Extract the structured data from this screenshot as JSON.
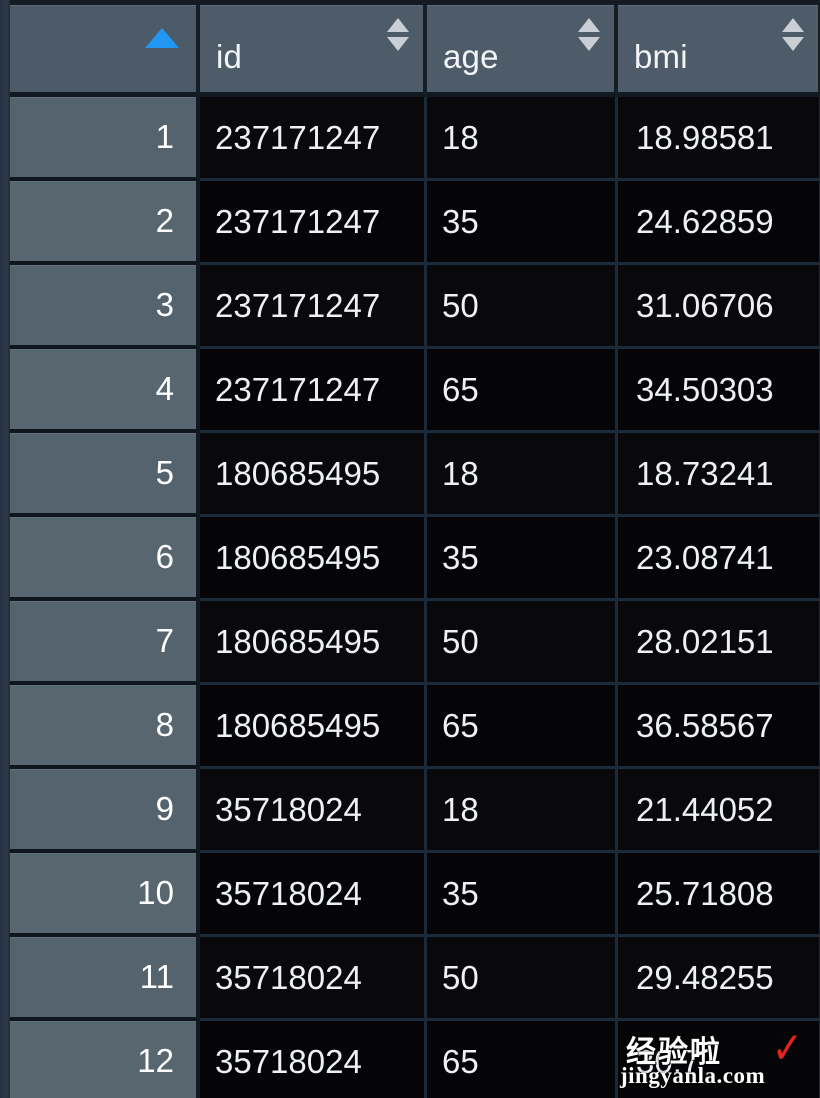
{
  "grid": {
    "sort": {
      "active_column": "row-number",
      "direction": "ascending",
      "accent_color": "#2196f3"
    },
    "colors": {
      "header_background": "#4e5c6a",
      "rownum_background": "#55636f",
      "cell_background": "#09090c",
      "cell_text": "#eef1f3",
      "grid_line": "#1b2a38"
    },
    "columns": [
      {
        "key": "rownum",
        "label": "",
        "sortable": true,
        "sort_state": "asc"
      },
      {
        "key": "id",
        "label": "id",
        "sortable": true,
        "sort_state": "none"
      },
      {
        "key": "age",
        "label": "age",
        "sortable": true,
        "sort_state": "none"
      },
      {
        "key": "bmi",
        "label": "bmi",
        "sortable": true,
        "sort_state": "none"
      }
    ],
    "rows": [
      {
        "rownum": "1",
        "id": "237171247",
        "age": "18",
        "bmi": "18.98581"
      },
      {
        "rownum": "2",
        "id": "237171247",
        "age": "35",
        "bmi": "24.62859"
      },
      {
        "rownum": "3",
        "id": "237171247",
        "age": "50",
        "bmi": "31.06706"
      },
      {
        "rownum": "4",
        "id": "237171247",
        "age": "65",
        "bmi": "34.50303"
      },
      {
        "rownum": "5",
        "id": "180685495",
        "age": "18",
        "bmi": "18.73241"
      },
      {
        "rownum": "6",
        "id": "180685495",
        "age": "35",
        "bmi": "23.08741"
      },
      {
        "rownum": "7",
        "id": "180685495",
        "age": "50",
        "bmi": "28.02151"
      },
      {
        "rownum": "8",
        "id": "180685495",
        "age": "65",
        "bmi": "36.58567"
      },
      {
        "rownum": "9",
        "id": "35718024",
        "age": "18",
        "bmi": "21.44052"
      },
      {
        "rownum": "10",
        "id": "35718024",
        "age": "35",
        "bmi": "25.71808"
      },
      {
        "rownum": "11",
        "id": "35718024",
        "age": "50",
        "bmi": "29.48255"
      },
      {
        "rownum": "12",
        "id": "35718024",
        "age": "65",
        "bmi": "30.7"
      }
    ]
  },
  "watermark": {
    "brand_cn": "经验啦",
    "check_glyph": "✓",
    "url": "jingyanla.com",
    "check_color": "#e2241c"
  }
}
